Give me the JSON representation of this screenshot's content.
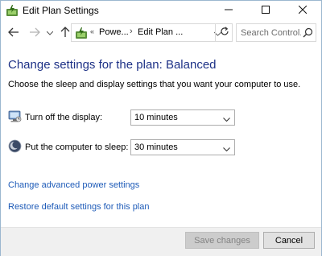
{
  "window": {
    "title": "Edit Plan Settings",
    "icon": "power-options-icon",
    "controls": [
      "minimize-icon",
      "maximize-icon",
      "close-icon"
    ]
  },
  "navigation": {
    "back_icon": "arrow-left-icon",
    "forward_icon": "arrow-right-icon",
    "recent_icon": "chevron-down-icon",
    "up_icon": "arrow-up-icon",
    "breadcrumb": {
      "overflow": "«",
      "items": [
        "Powe...",
        "Edit Plan ..."
      ],
      "separator": "›"
    },
    "refresh_icon": "refresh-icon",
    "search": {
      "placeholder": "Search Control..."
    }
  },
  "main": {
    "heading": "Change settings for the plan: Balanced",
    "description": "Choose the sleep and display settings that you want your computer to use.",
    "settings": [
      {
        "label": "Turn off the display:",
        "value": "10 minutes",
        "icon": "display-icon"
      },
      {
        "label": "Put the computer to sleep:",
        "value": "30 minutes",
        "icon": "sleep-moon-icon"
      }
    ],
    "links": {
      "advanced": "Change advanced power settings",
      "restore": "Restore default settings for this plan"
    }
  },
  "footer": {
    "save_label": "Save changes",
    "cancel_label": "Cancel"
  }
}
